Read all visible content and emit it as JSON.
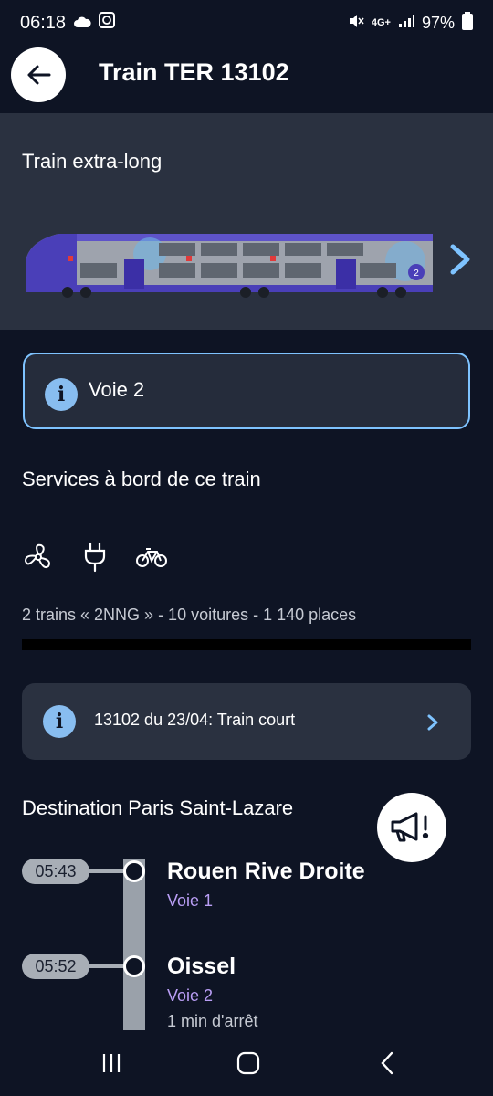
{
  "status": {
    "time": "06:18",
    "network": "4G+",
    "battery": "97%"
  },
  "header": {
    "title": "Train TER 13102"
  },
  "train": {
    "length_label": "Train extra-long",
    "car_number": "2"
  },
  "platform": {
    "label": "Voie 2"
  },
  "services": {
    "title": "Services à bord de ce train",
    "icons": [
      "fan-icon",
      "plug-icon",
      "bicycle-icon"
    ],
    "composition": "2 trains « 2NNG » - 10 voitures - 1 140 places"
  },
  "alert": {
    "text": "13102 du 23/04: Train court"
  },
  "destination": {
    "label": "Destination Paris Saint-Lazare"
  },
  "stops": [
    {
      "time": "05:43",
      "name": "Rouen Rive Droite",
      "voie": "Voie 1",
      "duration": ""
    },
    {
      "time": "05:52",
      "name": "Oissel",
      "voie": "Voie 2",
      "duration": "1 min d'arrêt"
    }
  ],
  "colors": {
    "background": "#0e1424",
    "panel": "#2a3140",
    "accent_blue": "#7ec3ff",
    "voie_purple": "#b99ef5"
  }
}
